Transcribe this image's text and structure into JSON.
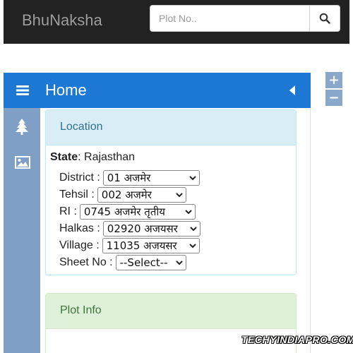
{
  "navbar": {
    "brand": "BhuNaksha",
    "search_placeholder": "Plot No..",
    "search_icon": "magnifier-icon"
  },
  "zoom": {
    "in_label": "+",
    "out_label": "−"
  },
  "sidebar": {
    "title": "Home",
    "icons": [
      "menu-icon",
      "tree-icon",
      "image-icon",
      "collapse-left-icon"
    ]
  },
  "location": {
    "heading": "Location",
    "state_label": "State",
    "state_value": ": Rajasthan",
    "fields": [
      {
        "label": "District :",
        "value": "01 अजमेर"
      },
      {
        "label": "Tehsil :",
        "value": "002 अजमेर"
      },
      {
        "label": "RI :",
        "value": "0745 अजमेर तृतीय"
      },
      {
        "label": "Halkas :",
        "value": "02920 अजयसर"
      },
      {
        "label": "Village :",
        "value": "11035 अजयसर"
      },
      {
        "label": "Sheet No :",
        "value": "--Select--"
      }
    ]
  },
  "plot_info": {
    "heading": "Plot Info"
  },
  "watermark": "TECHYINDIAPRO.COM",
  "colors": {
    "navbar_bg": "#222222",
    "home_bar_bg": "#1c78d4",
    "icon_strip_bg": "#7f9fc7",
    "location_heading_bg": "#d9edf7",
    "plot_heading_bg": "#dff0d8"
  }
}
